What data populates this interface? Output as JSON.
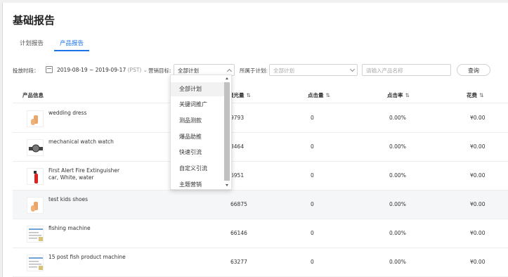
{
  "page": {
    "title": "基础报告"
  },
  "tabs": [
    {
      "label": "计划报告",
      "active": false
    },
    {
      "label": "产品报告",
      "active": true
    }
  ],
  "filters": {
    "period_label": "投放时段：",
    "date_range": "2019-08-19 ~ 2019-09-17",
    "timezone": "(PST)",
    "target_label": "营销目标:",
    "target_value": "全部计划",
    "plan_label": "所属于计划:",
    "plan_placeholder": "全部计划",
    "product_placeholder": "请输入产品名称",
    "query_button": "查询"
  },
  "table": {
    "columns": [
      "产品信息",
      "展光量",
      "点击量",
      "点击率",
      "花费"
    ],
    "sort_icon": "⇅",
    "rows": [
      {
        "name": "wedding dress",
        "impressions": "9793",
        "clicks": "0",
        "ctr": "0.00%",
        "cost": "¥0.00",
        "thumb": "hand-image"
      },
      {
        "name": "mechanical watch watch",
        "impressions": "3464",
        "clicks": "0",
        "ctr": "0.00%",
        "cost": "¥0.00",
        "thumb": "watch-image"
      },
      {
        "name": "First Alert Fire Extinguisher car, White, water",
        "impressions": "6951",
        "clicks": "0",
        "ctr": "0.00%",
        "cost": "¥0.00",
        "thumb": "extinguisher-image"
      },
      {
        "name": "test kids shoes",
        "impressions": "66875",
        "clicks": "0",
        "ctr": "0.00%",
        "cost": "¥0.00",
        "thumb": "hand-image"
      },
      {
        "name": "fishing machine",
        "impressions": "66146",
        "clicks": "0",
        "ctr": "0.00%",
        "cost": "¥0.00",
        "thumb": "document-image"
      },
      {
        "name": "15 post fish product machine",
        "impressions": "63277",
        "clicks": "0",
        "ctr": "0.00%",
        "cost": "¥0.00",
        "thumb": "document-image"
      }
    ]
  },
  "dropdown": {
    "items": [
      "全部计划",
      "关键词推广",
      "测品测款",
      "爆品助推",
      "快速引流",
      "自定义引流",
      "主题营销"
    ],
    "selected": "全部计划"
  },
  "colors": {
    "accent": "#1a73e8",
    "row_highlight": "#f5f6f8"
  }
}
